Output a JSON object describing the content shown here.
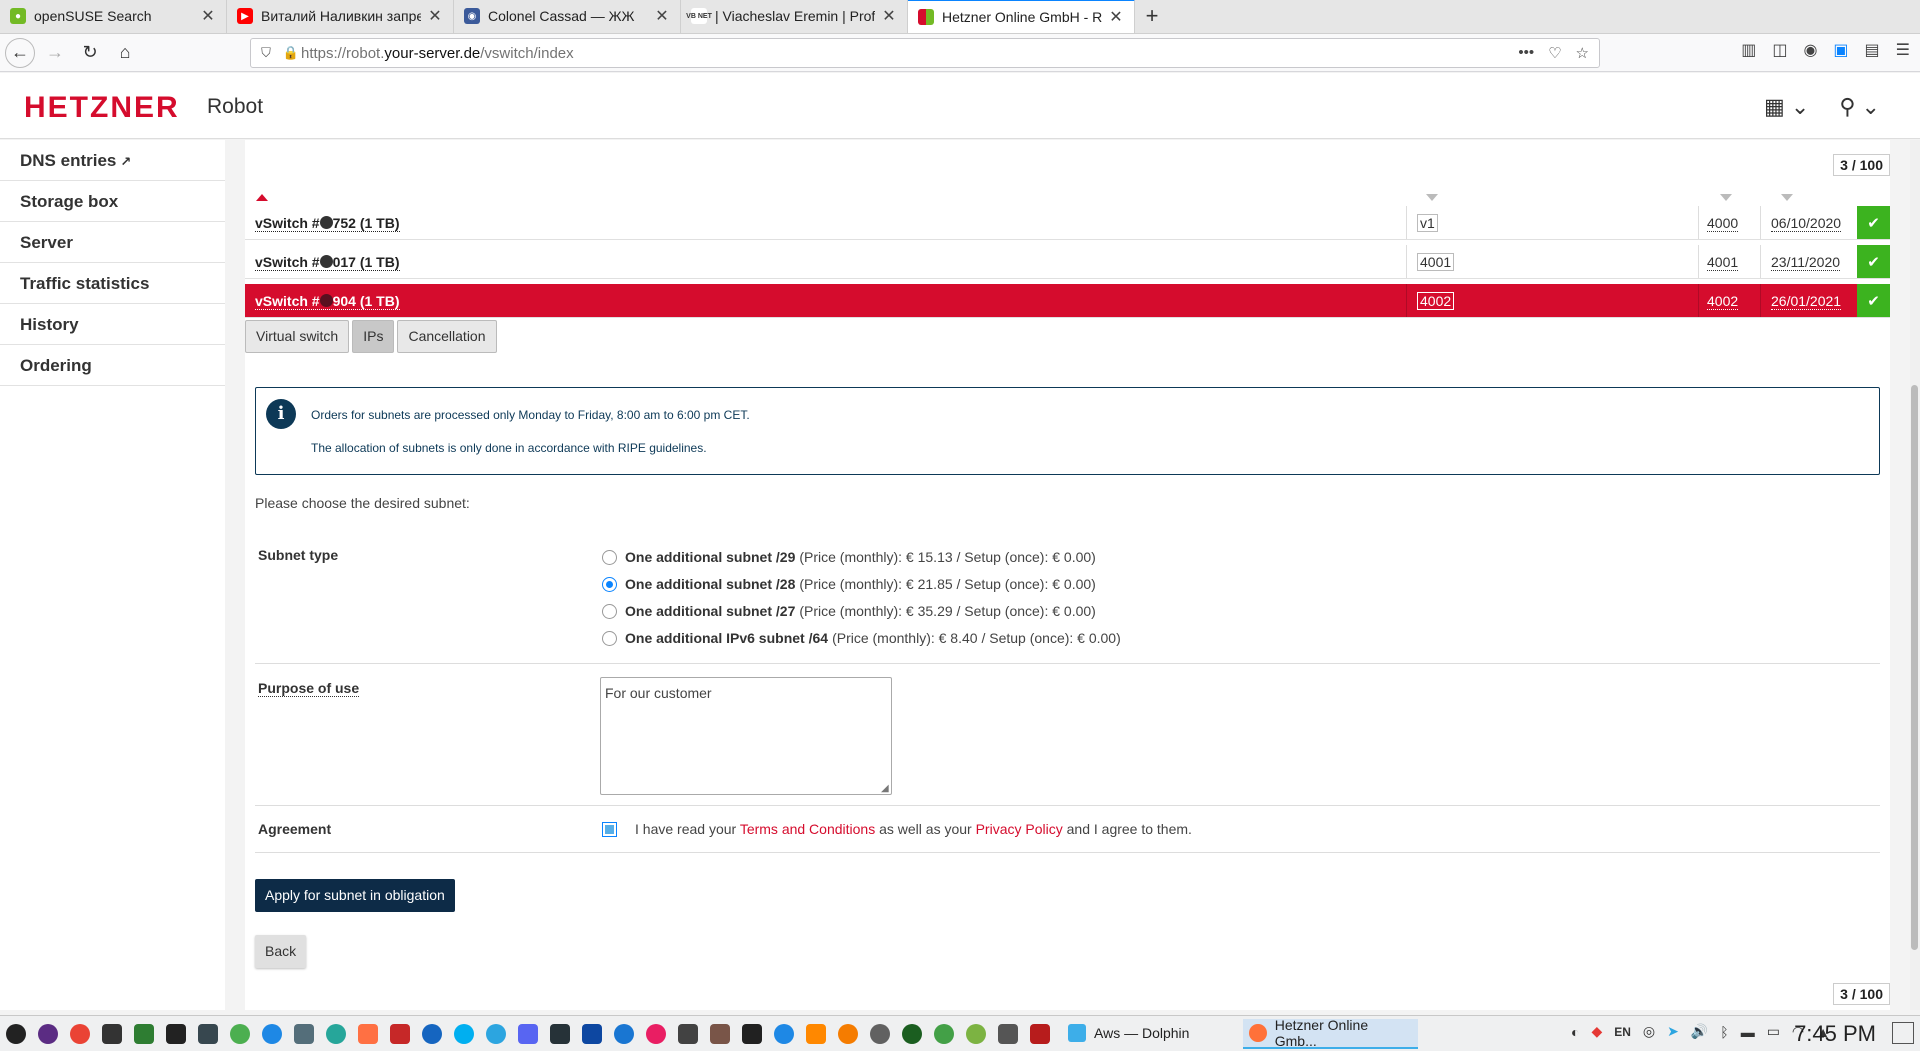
{
  "browser": {
    "tabs": [
      {
        "label": "openSUSE Search",
        "icon_color": "#73ba25",
        "active": false
      },
      {
        "label": "Виталий Наливкин запре",
        "icon_color": "#ff0000",
        "active": false
      },
      {
        "label": "Colonel Cassad — ЖЖ",
        "icon_color": "#3b5a9a",
        "active": false
      },
      {
        "label": "| Viacheslav Eremin | Prof",
        "icon_color": "#333333",
        "icon_text": "VB NET",
        "active": false
      },
      {
        "label": "Hetzner Online GmbH - Ro",
        "icon_color": "#d50c2d",
        "active": true
      }
    ],
    "url_prefix": "https://robot.",
    "url_host": "your-server.de",
    "url_path": "/vswitch/index"
  },
  "header": {
    "brand": "HETZNER",
    "product": "Robot"
  },
  "sidebar": {
    "items": [
      {
        "label": "DNS entries"
      },
      {
        "label": "Storage box"
      },
      {
        "label": "Server"
      },
      {
        "label": "Traffic statistics"
      },
      {
        "label": "History"
      },
      {
        "label": "Ordering"
      }
    ]
  },
  "main": {
    "counter_top": "3 / 100",
    "counter_bottom": "3 / 100",
    "vswitches": [
      {
        "name_a": "vSwitch #",
        "name_b": "752 (1 TB)",
        "name_field": "v1",
        "vlan": "4000",
        "date": "06/10/2020",
        "selected": false
      },
      {
        "name_a": "vSwitch #",
        "name_b": "017 (1 TB)",
        "name_field": "4001",
        "vlan": "4001",
        "date": "23/11/2020",
        "selected": false
      },
      {
        "name_a": "vSwitch #",
        "name_b": "904 (1 TB)",
        "name_field": "4002",
        "vlan": "4002",
        "date": "26/01/2021",
        "selected": true
      }
    ],
    "subtabs": [
      {
        "label": "Virtual switch",
        "active": false
      },
      {
        "label": "IPs",
        "active": true
      },
      {
        "label": "Cancellation",
        "active": false
      }
    ],
    "info": {
      "line1": "Orders for subnets are processed only Monday to Friday, 8:00 am to 6:00 pm CET.",
      "line2": "The allocation of subnets is only done in accordance with RIPE guidelines."
    },
    "choose_text": "Please choose the desired subnet:",
    "subnet_type_label": "Subnet type",
    "subnet_options": [
      {
        "bold": "One additional subnet /29",
        "rest": "(Price (monthly): € 15.13 / Setup (once): € 0.00)",
        "checked": false
      },
      {
        "bold": "One additional subnet /28",
        "rest": "(Price (monthly): € 21.85 / Setup (once): € 0.00)",
        "checked": true
      },
      {
        "bold": "One additional subnet /27",
        "rest": "(Price (monthly): € 35.29 / Setup (once): € 0.00)",
        "checked": false
      },
      {
        "bold": "One additional IPv6 subnet /64",
        "rest": "(Price (monthly): € 8.40 / Setup (once): € 0.00)",
        "checked": false
      }
    ],
    "purpose_label": "Purpose of use",
    "purpose_value": "For our customer",
    "agreement_label": "Agreement",
    "agreement": {
      "pre": "I have read your",
      "terms": "Terms and Conditions",
      "mid": "as well as your",
      "privacy": "Privacy Policy",
      "post": "and I agree to them."
    },
    "apply_button": "Apply for subnet in obligation",
    "back_button": "Back"
  },
  "taskbar": {
    "tasks": [
      {
        "label": "Aws — Dolphin",
        "active": false
      },
      {
        "label": "Hetzner Online Gmb...",
        "active": true
      }
    ],
    "lang": "EN",
    "clock": "7:45 PM"
  },
  "colors": {
    "brand_red": "#d50c2d",
    "check_green": "#3cb31f",
    "navy": "#0d2b47"
  }
}
